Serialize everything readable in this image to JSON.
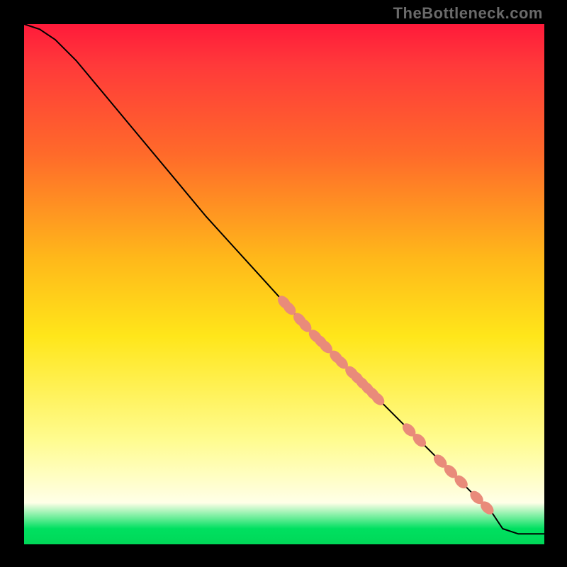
{
  "watermark": "TheBottleneck.com",
  "colors": {
    "curve": "#000000",
    "marker_fill": "#e98b7a",
    "marker_stroke": "#d46b5c"
  },
  "chart_data": {
    "type": "line",
    "title": "",
    "xlabel": "",
    "ylabel": "",
    "xlim": [
      0,
      100
    ],
    "ylim": [
      0,
      100
    ],
    "series": [
      {
        "name": "curve",
        "x": [
          0,
          3,
          6,
          10,
          15,
          20,
          25,
          30,
          35,
          40,
          45,
          50,
          55,
          60,
          65,
          70,
          75,
          80,
          85,
          90,
          92,
          95,
          100
        ],
        "values": [
          100,
          99,
          97,
          93,
          87,
          81,
          75,
          69,
          63,
          57.5,
          52,
          46.5,
          41,
          36,
          31,
          26,
          21,
          16,
          11,
          6,
          3,
          2,
          2
        ]
      }
    ],
    "markers": {
      "on_series": "curve",
      "x_positions": [
        50,
        51,
        53,
        54,
        56,
        57,
        58,
        60,
        61,
        63,
        64,
        65,
        66,
        67,
        68,
        74,
        76,
        80,
        82,
        84,
        87,
        89
      ]
    }
  }
}
